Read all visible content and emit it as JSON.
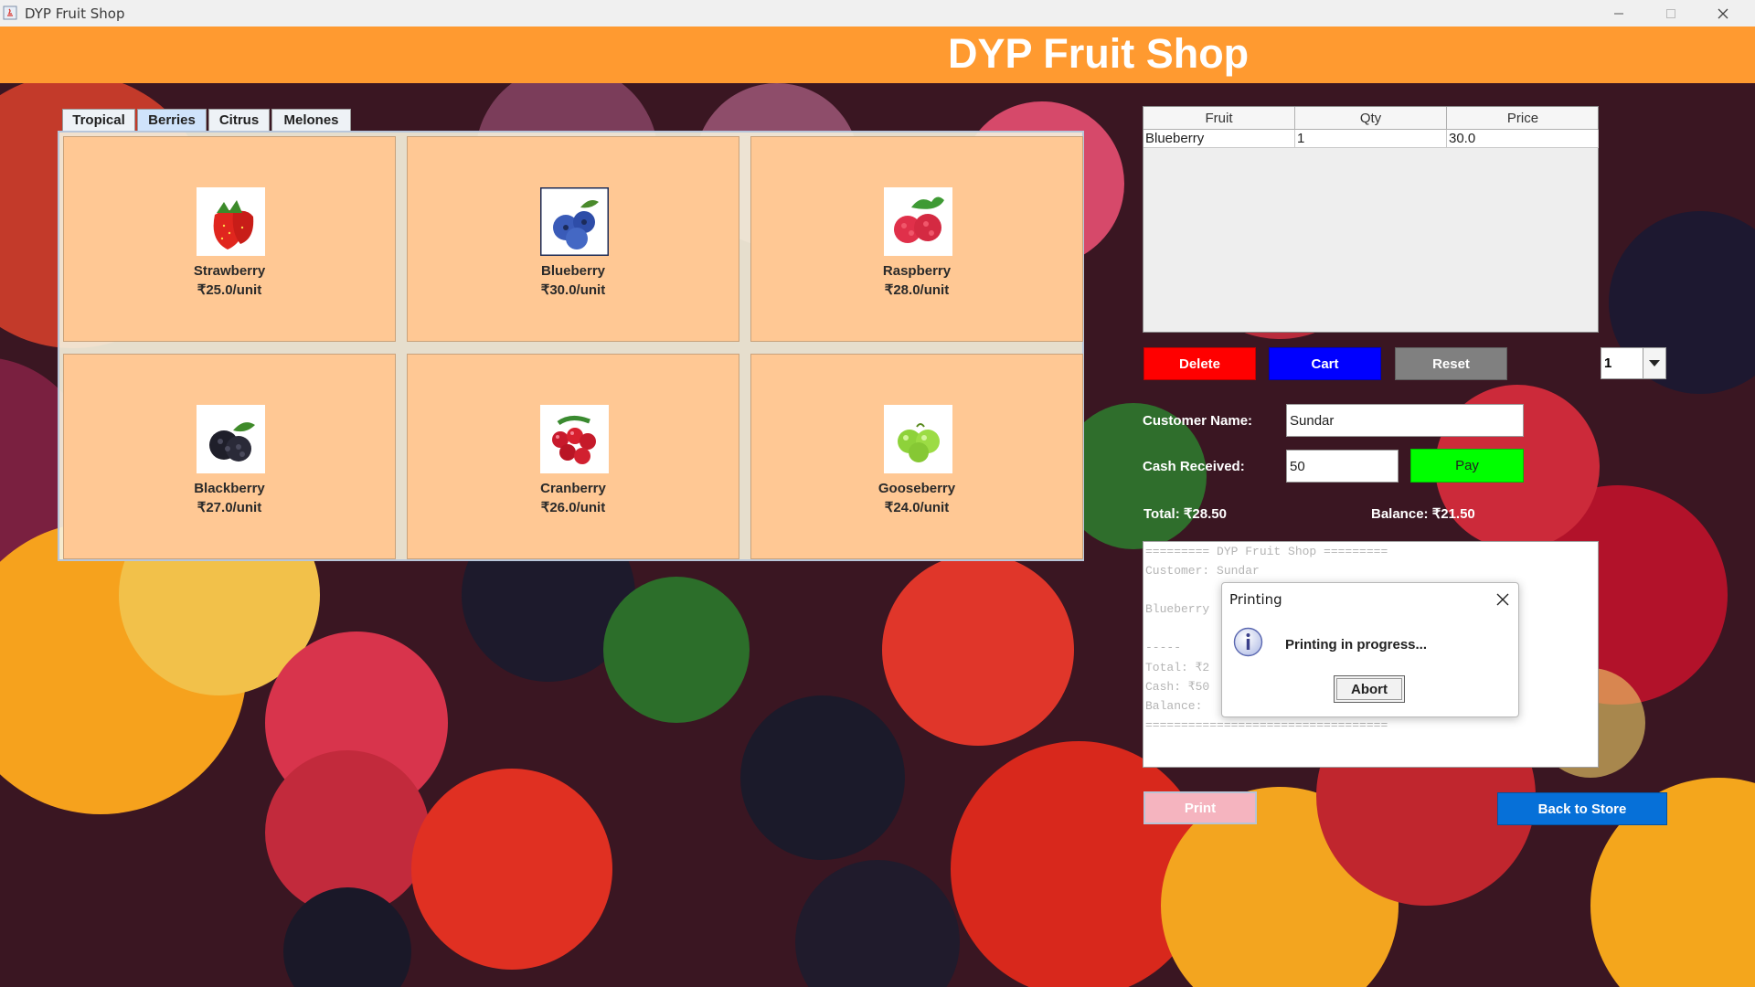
{
  "window": {
    "title": "DYP Fruit Shop",
    "controls": [
      "minimize-icon",
      "maximize-icon",
      "close-icon"
    ]
  },
  "header": {
    "title": "DYP Fruit Shop",
    "color": "#ff9a30"
  },
  "tabs": [
    {
      "label": "Tropical",
      "active": false
    },
    {
      "label": "Berries",
      "active": true
    },
    {
      "label": "Citrus",
      "active": false
    },
    {
      "label": "Melones",
      "active": false
    }
  ],
  "fruits": [
    {
      "name": "Strawberry",
      "price": "₹25.0/unit",
      "icon": "strawberry-icon"
    },
    {
      "name": "Blueberry",
      "price": "₹30.0/unit",
      "icon": "blueberry-icon"
    },
    {
      "name": "Raspberry",
      "price": "₹28.0/unit",
      "icon": "raspberry-icon"
    },
    {
      "name": "Blackberry",
      "price": "₹27.0/unit",
      "icon": "blackberry-icon"
    },
    {
      "name": "Cranberry",
      "price": "₹26.0/unit",
      "icon": "cranberry-icon"
    },
    {
      "name": "Gooseberry",
      "price": "₹24.0/unit",
      "icon": "gooseberry-icon"
    }
  ],
  "cart": {
    "columns": [
      "Fruit",
      "Qty",
      "Price"
    ],
    "rows": [
      {
        "fruit": "Blueberry",
        "qty": "1",
        "price": "30.0"
      }
    ]
  },
  "actions": {
    "delete_label": "Delete",
    "cart_label": "Cart",
    "reset_label": "Reset",
    "quantity_selected": "1",
    "pay_label": "Pay",
    "print_label": "Print",
    "back_label": "Back to Store"
  },
  "form": {
    "customer_label": "Customer Name:",
    "customer_value": "Sundar",
    "cash_label": "Cash Received:",
    "cash_value": "50"
  },
  "totals": {
    "total": "Total: ₹28.50",
    "balance": "Balance: ₹21.50"
  },
  "receipt_lines": [
    "========= DYP Fruit Shop =========",
    "Customer: Sundar",
    "",
    "Blueberry",
    "",
    "-----",
    "Total: ₹2",
    "Cash: ₹50",
    "Balance:",
    "=================================="
  ],
  "dialog": {
    "title": "Printing",
    "message": "Printing in progress...",
    "abort_label": "Abort",
    "icon": "info-icon"
  },
  "colors": {
    "delete": "#ff0000",
    "cart": "#0000ff",
    "reset": "#808080",
    "pay": "#00ff00",
    "print": "#f5b4bf",
    "back": "#0670d8",
    "card": "#ffc894"
  }
}
